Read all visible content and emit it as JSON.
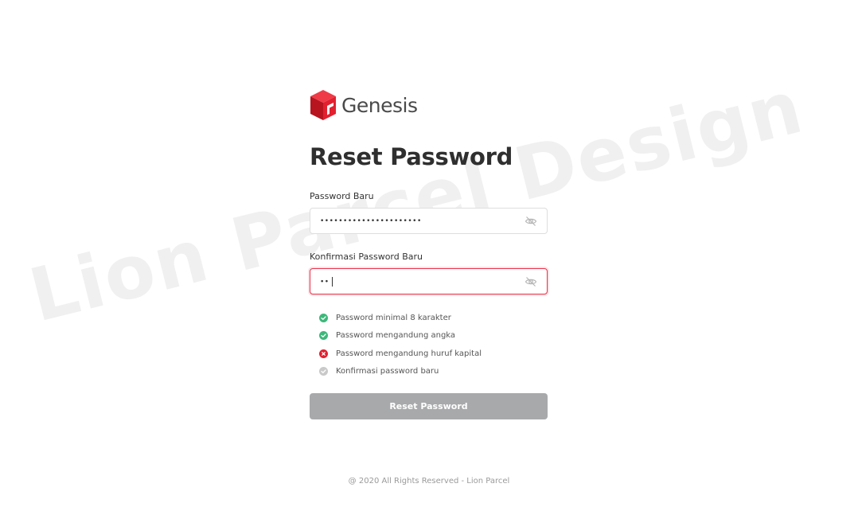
{
  "watermark": "Lion Parcel Design",
  "brand": {
    "name": "Genesis",
    "logo_icon": "cube-logo-icon",
    "color": "#e2202f"
  },
  "form": {
    "title": "Reset Password",
    "new_password": {
      "label": "Password Baru",
      "value": "••••••••••••••••••••••",
      "toggle_icon": "eye-off-icon"
    },
    "confirm_password": {
      "label": "Konfirmasi Password Baru",
      "value": "••",
      "state": "error",
      "border_color": "#e8324a",
      "toggle_icon": "eye-off-icon"
    },
    "rules": [
      {
        "text": "Password minimal 8 karakter",
        "status": "valid",
        "icon": "check-circle-icon",
        "color": "#3db87a"
      },
      {
        "text": "Password mengandung angka",
        "status": "valid",
        "icon": "check-circle-icon",
        "color": "#3db87a"
      },
      {
        "text": "Password mengandung huruf kapital",
        "status": "invalid",
        "icon": "x-circle-icon",
        "color": "#e2202f"
      },
      {
        "text": "Konfirmasi password baru",
        "status": "pending",
        "icon": "check-circle-icon",
        "color": "#c9c9c9"
      }
    ],
    "submit_label": "Reset Password",
    "submit_enabled": false,
    "submit_color": "#a8a9ab"
  },
  "footer": {
    "text": "@ 2020 All Rights Reserved - Lion Parcel"
  }
}
